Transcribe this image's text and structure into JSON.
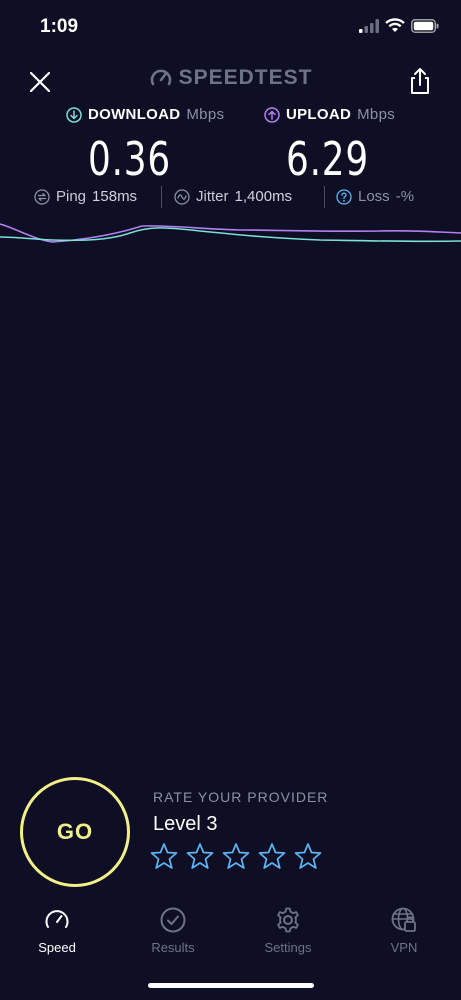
{
  "status_bar": {
    "time": "1:09"
  },
  "header": {
    "brand": "SPEEDTEST",
    "close_icon": "close-icon",
    "share_icon": "share-icon"
  },
  "results": {
    "download": {
      "label": "DOWNLOAD",
      "unit": "Mbps",
      "value": "0.36",
      "color": "#7be0d6"
    },
    "upload": {
      "label": "UPLOAD",
      "unit": "Mbps",
      "value": "6.29",
      "color": "#b27ff0"
    }
  },
  "metrics": {
    "ping": {
      "label": "Ping",
      "value": "158",
      "unit": "ms"
    },
    "jitter": {
      "label": "Jitter",
      "value": "1,400",
      "unit": "ms"
    },
    "loss": {
      "label": "Loss",
      "value": "-",
      "unit": "%"
    }
  },
  "go_button": {
    "label": "GO",
    "color": "#f3f08a"
  },
  "rating": {
    "title": "RATE YOUR PROVIDER",
    "provider": "Level 3",
    "star_count": 5,
    "star_color": "#5fb4f5"
  },
  "tabs": [
    {
      "label": "Speed",
      "icon": "speedometer-icon",
      "active": true
    },
    {
      "label": "Results",
      "icon": "checkmark-circle-icon",
      "active": false
    },
    {
      "label": "Settings",
      "icon": "gear-icon",
      "active": false
    },
    {
      "label": "VPN",
      "icon": "globe-lock-icon",
      "active": false
    }
  ]
}
